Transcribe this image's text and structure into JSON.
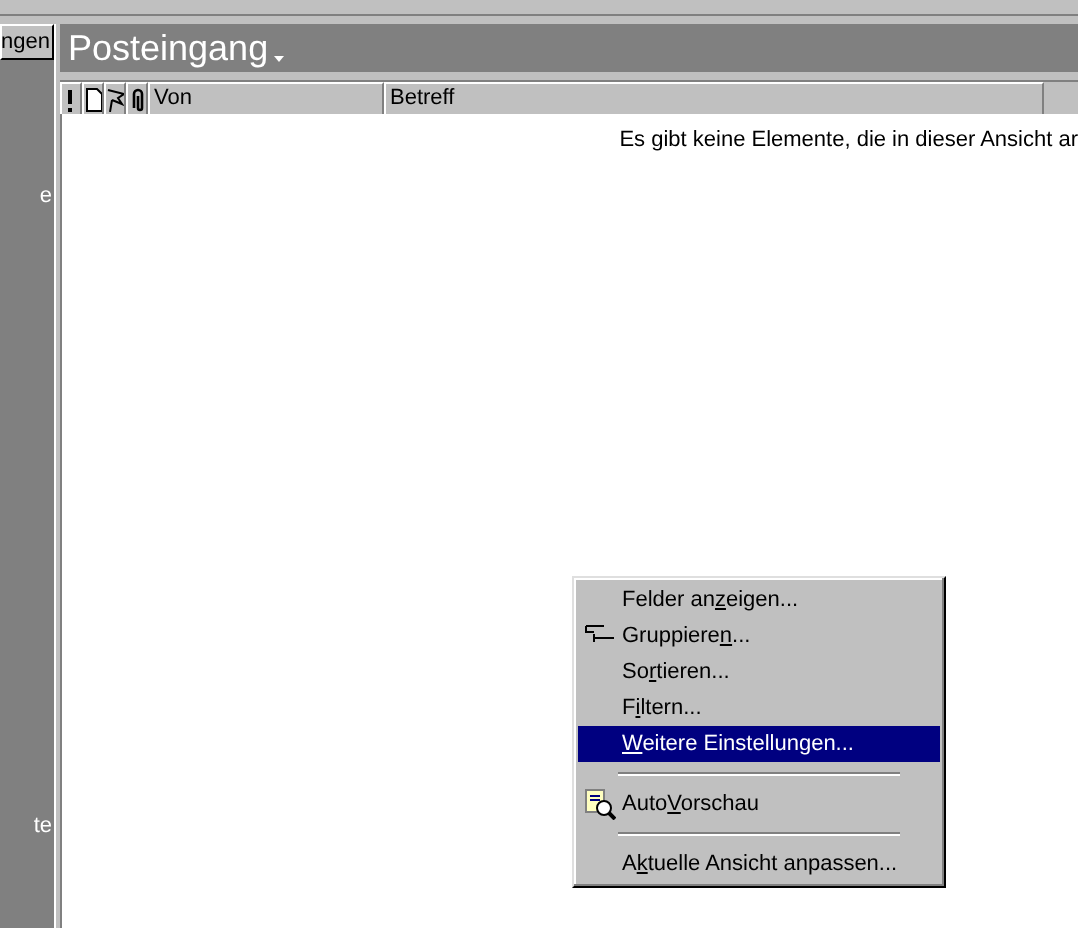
{
  "sidebar": {
    "button": "ngen",
    "texts": [
      "e",
      "te"
    ]
  },
  "folder": {
    "title": "Posteingang"
  },
  "columns": [
    {
      "kind": "importance"
    },
    {
      "kind": "type"
    },
    {
      "kind": "flag"
    },
    {
      "kind": "attachment"
    },
    {
      "kind": "text",
      "label": "Von"
    },
    {
      "kind": "text",
      "label": "Betreff"
    }
  ],
  "empty_message": "Es gibt keine Elemente, die in dieser Ansicht ar",
  "context_menu": [
    {
      "kind": "item",
      "before": "Felder an",
      "key": "z",
      "after": "eigen...",
      "selected": false
    },
    {
      "kind": "grouping",
      "before": "Gruppiere",
      "key": "n",
      "after": "...",
      "selected": false
    },
    {
      "kind": "item",
      "before": "So",
      "key": "r",
      "after": "tieren...",
      "selected": false
    },
    {
      "kind": "item",
      "before": "F",
      "key": "i",
      "after": "ltern...",
      "selected": false
    },
    {
      "kind": "item",
      "key": "W",
      "after": "eitere Einstellungen...",
      "selected": true
    },
    {
      "kind": "separator"
    },
    {
      "kind": "preview",
      "before": "Auto",
      "key": "V",
      "after": "orschau",
      "selected": false
    },
    {
      "kind": "separator"
    },
    {
      "kind": "item",
      "before": "A",
      "key": "k",
      "after": "tuelle Ansicht anpassen...",
      "selected": false
    }
  ]
}
